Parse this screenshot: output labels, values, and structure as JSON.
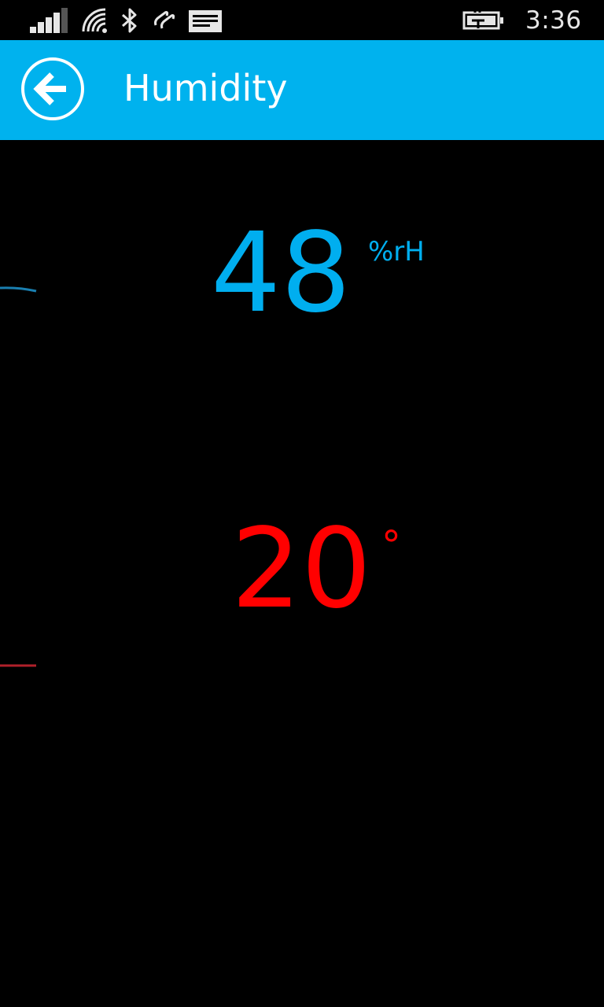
{
  "status_bar": {
    "time": "3:36",
    "icons": [
      "signal-icon",
      "wifi-icon",
      "bluetooth-icon",
      "nfc-icon",
      "message-icon",
      "battery-charging-icon"
    ]
  },
  "header": {
    "title": "Humidity",
    "back_icon": "back-arrow-icon",
    "background_color": "#00b2ee"
  },
  "readings": {
    "humidity": {
      "value": "48",
      "unit": "%rH",
      "color": "#00aeef"
    },
    "temperature": {
      "value": "20",
      "unit": "°",
      "color": "#ff0000"
    }
  }
}
